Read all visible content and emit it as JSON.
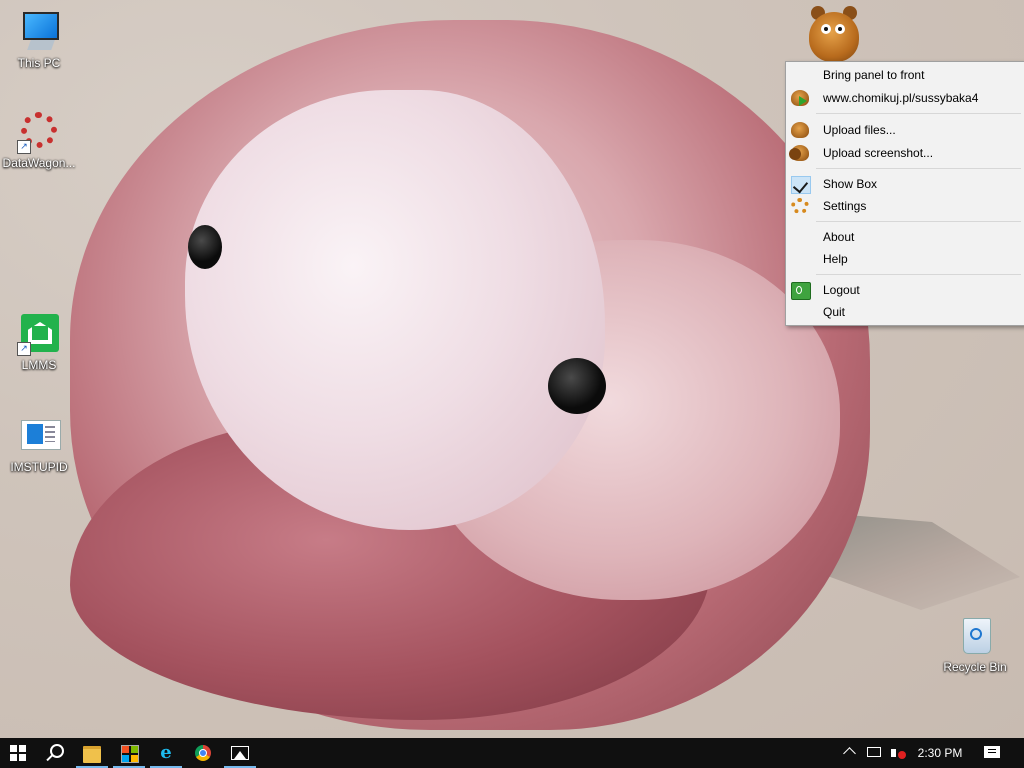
{
  "desktop": {
    "icons": [
      {
        "label": "This PC",
        "icon": "this-pc-icon"
      },
      {
        "label": "DataWagon...",
        "icon": "datawagon-icon"
      },
      {
        "label": "LMMS",
        "icon": "lmms-icon"
      },
      {
        "label": "IMSTUPID",
        "icon": "document-icon"
      },
      {
        "label": "Recycle Bin",
        "icon": "recycle-bin-icon"
      }
    ]
  },
  "tray_app": {
    "icon": "hamster-mascot-icon"
  },
  "context_menu": {
    "items": [
      {
        "label": "Bring panel to front",
        "icon": ""
      },
      {
        "label": "www.chomikuj.pl/sussybaka4",
        "icon": "hamster-arrow-icon"
      },
      {
        "label": "Upload files...",
        "icon": "hamster-upload-icon"
      },
      {
        "label": "Upload screenshot...",
        "icon": "hamster-screenshot-icon"
      },
      {
        "label": "Show Box",
        "icon": "checkmark-icon",
        "checked": true
      },
      {
        "label": "Settings",
        "icon": "gear-icon"
      },
      {
        "label": "About",
        "icon": ""
      },
      {
        "label": "Help",
        "icon": ""
      },
      {
        "label": "Logout",
        "icon": "power-icon"
      },
      {
        "label": "Quit",
        "icon": ""
      }
    ]
  },
  "taskbar": {
    "pinned": [
      {
        "name": "Start",
        "icon": "windows-logo-icon"
      },
      {
        "name": "Search",
        "icon": "search-icon"
      },
      {
        "name": "File Explorer",
        "icon": "folder-icon",
        "active": true
      },
      {
        "name": "Store",
        "icon": "store-icon",
        "active": true
      },
      {
        "name": "Internet Explorer",
        "icon": "ie-icon",
        "active": true
      },
      {
        "name": "Google Chrome",
        "icon": "chrome-icon"
      },
      {
        "name": "Photos",
        "icon": "photos-icon",
        "active": true
      }
    ],
    "tray": {
      "chevron_icon": "chevron-up-icon",
      "network_icon": "network-icon",
      "volume_icon": "volume-muted-icon",
      "time": "2:30 PM",
      "notification_icon": "action-center-icon"
    }
  },
  "colors": {
    "taskbar_bg": "#101010",
    "menu_bg": "#f2f2f2",
    "active_indicator": "#76b9ed"
  }
}
